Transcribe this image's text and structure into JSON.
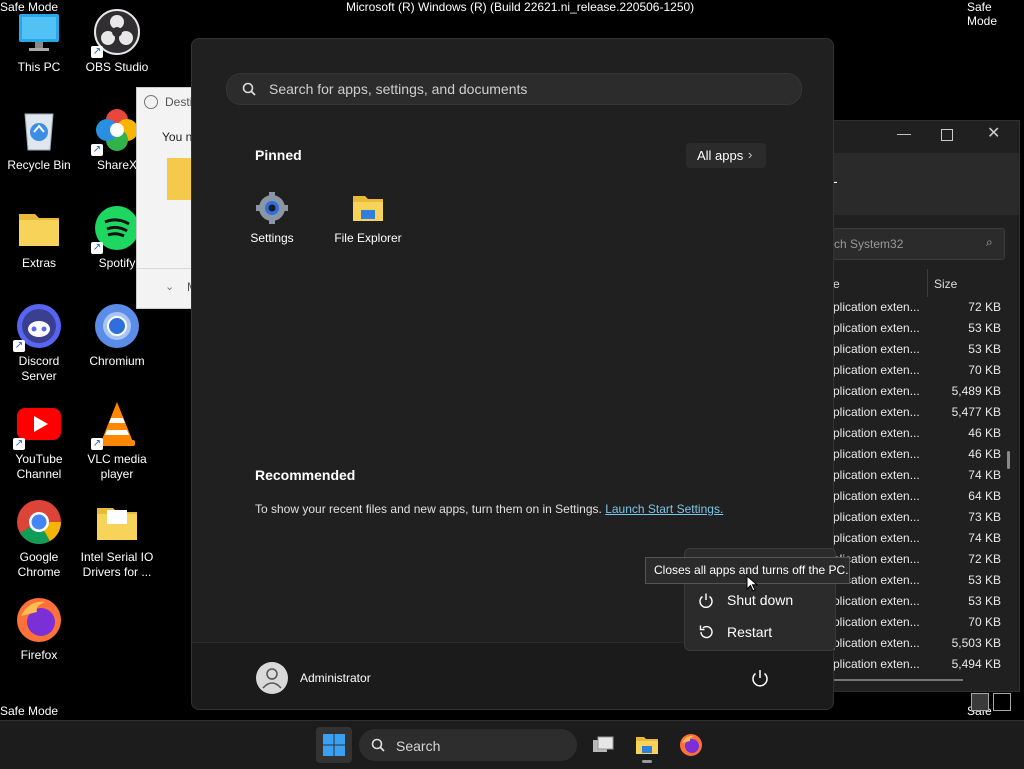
{
  "top": {
    "safe_mode_tl": "Safe Mode",
    "safe_mode_tr": "Safe Mode",
    "safe_mode_bl": "Safe Mode",
    "safe_mode_br": "Safe Mode",
    "build": "Microsoft (R) Windows (R) (Build 22621.ni_release.220506-1250)"
  },
  "desktop": {
    "icons": [
      {
        "label": "This PC",
        "icon": "monitor-icon"
      },
      {
        "label": "OBS Studio",
        "icon": "obs-icon"
      },
      {
        "label": "Recycle Bin",
        "icon": "recycle-bin-icon"
      },
      {
        "label": "ShareX",
        "icon": "sharex-icon"
      },
      {
        "label": "Extras",
        "icon": "folder-icon"
      },
      {
        "label": "Spotify",
        "icon": "spotify-icon"
      },
      {
        "label": "Discord Server",
        "icon": "discord-icon"
      },
      {
        "label": "Chromium",
        "icon": "chromium-icon"
      },
      {
        "label": "YouTube Channel",
        "icon": "youtube-icon"
      },
      {
        "label": "VLC media player",
        "icon": "vlc-icon"
      },
      {
        "label": "Google Chrome",
        "icon": "chrome-icon"
      },
      {
        "label": "Intel Serial IO Drivers for ...",
        "icon": "folder-icon"
      },
      {
        "label": "Firefox",
        "icon": "firefox-icon"
      }
    ]
  },
  "dialog": {
    "title": "Desti",
    "line": "You n",
    "more": "M"
  },
  "explorer": {
    "search_placeholder": "ch System32",
    "col_type": "e",
    "col_size": "Size",
    "title_char": "-",
    "rows": [
      {
        "type": "plication exten...",
        "size": "72 KB"
      },
      {
        "type": "plication exten...",
        "size": "53 KB"
      },
      {
        "type": "plication exten...",
        "size": "53 KB"
      },
      {
        "type": "plication exten...",
        "size": "70 KB"
      },
      {
        "type": "plication exten...",
        "size": "5,489 KB"
      },
      {
        "type": "plication exten...",
        "size": "5,477 KB"
      },
      {
        "type": "plication exten...",
        "size": "46 KB"
      },
      {
        "type": "plication exten...",
        "size": "46 KB"
      },
      {
        "type": "plication exten...",
        "size": "74 KB"
      },
      {
        "type": "plication exten...",
        "size": "64 KB"
      },
      {
        "type": "plication exten...",
        "size": "73 KB"
      },
      {
        "type": "plication exten...",
        "size": "74 KB"
      },
      {
        "type": "plication exten...",
        "size": "72 KB"
      },
      {
        "type": "plication exten...",
        "size": "53 KB"
      },
      {
        "type": "plication exten...",
        "size": "53 KB"
      },
      {
        "type": "plication exten...",
        "size": "70 KB"
      },
      {
        "type": "plication exten...",
        "size": "5,503 KB"
      },
      {
        "type": "plication exten...",
        "size": "5,494 KB"
      }
    ]
  },
  "start": {
    "search_placeholder": "Search for apps, settings, and documents",
    "pinned_title": "Pinned",
    "all_apps_label": "All apps",
    "pinned": [
      {
        "label": "Settings",
        "icon": "settings-gear-icon"
      },
      {
        "label": "File Explorer",
        "icon": "file-explorer-icon"
      }
    ],
    "recommended_title": "Recommended",
    "recommended_text": "To show your recent files and new apps, turn them on in Settings.",
    "recommended_link": "Launch Start Settings.",
    "user_name": "Administrator"
  },
  "power_menu": {
    "tooltip": "Closes all apps and turns off the PC.",
    "items": [
      {
        "label": "Shut down",
        "icon": "power-icon"
      },
      {
        "label": "Restart",
        "icon": "restart-icon"
      }
    ]
  },
  "taskbar": {
    "search_label": "Search"
  },
  "colors": {
    "accent": "#0078d4",
    "link": "#7ac6e8",
    "start_bg": "#202020"
  }
}
